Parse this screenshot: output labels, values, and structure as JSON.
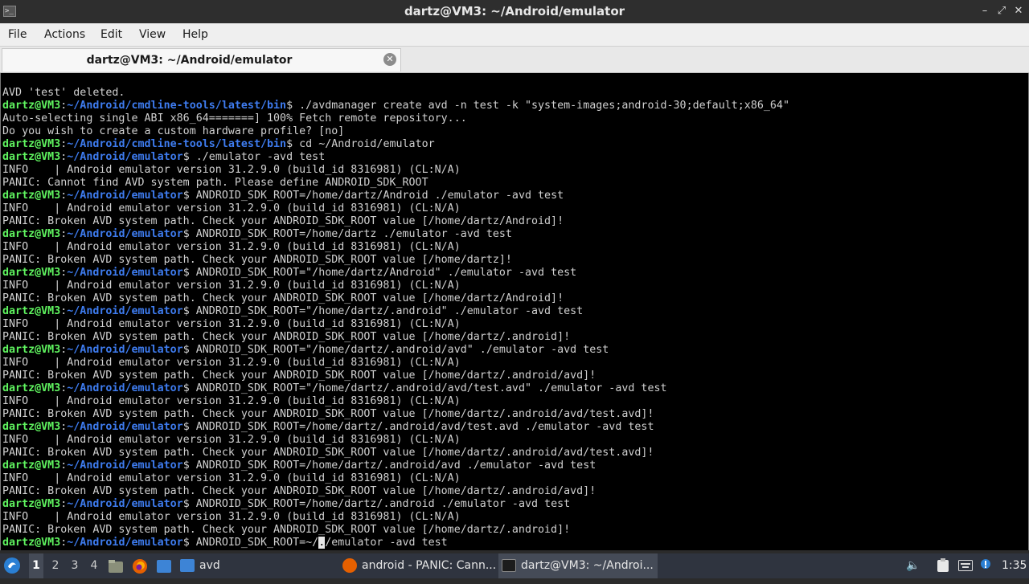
{
  "window": {
    "title": "dartz@VM3: ~/Android/emulator",
    "app_icon": "terminal-icon",
    "controls": {
      "minimize": "minimize-icon",
      "maximize": "maximize-icon",
      "close": "close-icon"
    }
  },
  "menu": {
    "items": [
      "File",
      "Actions",
      "Edit",
      "View",
      "Help"
    ]
  },
  "tab": {
    "title": "dartz@VM3: ~/Android/emulator",
    "close_icon": "close-circle-icon"
  },
  "terminal": {
    "colors": {
      "background": "#000000",
      "text": "#d0d0d0",
      "user": "#5ff35f",
      "path": "#3e7cf0"
    },
    "lines": [
      {
        "text": "AVD 'test' deleted."
      },
      {
        "user": "dartz@VM3",
        "path": "~/Android/cmdline-tools/latest/bin",
        "cmd": " ./avdmanager create avd -n test -k \"system-images;android-30;default;x86_64\""
      },
      {
        "text": "Auto-selecting single ABI x86_64=======] 100% Fetch remote repository..."
      },
      {
        "text": "Do you wish to create a custom hardware profile? [no]"
      },
      {
        "user": "dartz@VM3",
        "path": "~/Android/cmdline-tools/latest/bin",
        "cmd": " cd ~/Android/emulator"
      },
      {
        "user": "dartz@VM3",
        "path": "~/Android/emulator",
        "cmd": " ./emulator -avd test"
      },
      {
        "text": "INFO    | Android emulator version 31.2.9.0 (build_id 8316981) (CL:N/A)"
      },
      {
        "text": "PANIC: Cannot find AVD system path. Please define ANDROID_SDK_ROOT"
      },
      {
        "user": "dartz@VM3",
        "path": "~/Android/emulator",
        "cmd": " ANDROID_SDK_ROOT=/home/dartz/Android ./emulator -avd test"
      },
      {
        "text": "INFO    | Android emulator version 31.2.9.0 (build_id 8316981) (CL:N/A)"
      },
      {
        "text": "PANIC: Broken AVD system path. Check your ANDROID_SDK_ROOT value [/home/dartz/Android]!"
      },
      {
        "user": "dartz@VM3",
        "path": "~/Android/emulator",
        "cmd": " ANDROID_SDK_ROOT=/home/dartz ./emulator -avd test"
      },
      {
        "text": "INFO    | Android emulator version 31.2.9.0 (build_id 8316981) (CL:N/A)"
      },
      {
        "text": "PANIC: Broken AVD system path. Check your ANDROID_SDK_ROOT value [/home/dartz]!"
      },
      {
        "user": "dartz@VM3",
        "path": "~/Android/emulator",
        "cmd": " ANDROID_SDK_ROOT=\"/home/dartz/Android\" ./emulator -avd test"
      },
      {
        "text": "INFO    | Android emulator version 31.2.9.0 (build_id 8316981) (CL:N/A)"
      },
      {
        "text": "PANIC: Broken AVD system path. Check your ANDROID_SDK_ROOT value [/home/dartz/Android]!"
      },
      {
        "user": "dartz@VM3",
        "path": "~/Android/emulator",
        "cmd": " ANDROID_SDK_ROOT=\"/home/dartz/.android\" ./emulator -avd test"
      },
      {
        "text": "INFO    | Android emulator version 31.2.9.0 (build_id 8316981) (CL:N/A)"
      },
      {
        "text": "PANIC: Broken AVD system path. Check your ANDROID_SDK_ROOT value [/home/dartz/.android]!"
      },
      {
        "user": "dartz@VM3",
        "path": "~/Android/emulator",
        "cmd": " ANDROID_SDK_ROOT=\"/home/dartz/.android/avd\" ./emulator -avd test"
      },
      {
        "text": "INFO    | Android emulator version 31.2.9.0 (build_id 8316981) (CL:N/A)"
      },
      {
        "text": "PANIC: Broken AVD system path. Check your ANDROID_SDK_ROOT value [/home/dartz/.android/avd]!"
      },
      {
        "user": "dartz@VM3",
        "path": "~/Android/emulator",
        "cmd": " ANDROID_SDK_ROOT=\"/home/dartz/.android/avd/test.avd\" ./emulator -avd test"
      },
      {
        "text": "INFO    | Android emulator version 31.2.9.0 (build_id 8316981) (CL:N/A)"
      },
      {
        "text": "PANIC: Broken AVD system path. Check your ANDROID_SDK_ROOT value [/home/dartz/.android/avd/test.avd]!"
      },
      {
        "user": "dartz@VM3",
        "path": "~/Android/emulator",
        "cmd": " ANDROID_SDK_ROOT=/home/dartz/.android/avd/test.avd ./emulator -avd test"
      },
      {
        "text": "INFO    | Android emulator version 31.2.9.0 (build_id 8316981) (CL:N/A)"
      },
      {
        "text": "PANIC: Broken AVD system path. Check your ANDROID_SDK_ROOT value [/home/dartz/.android/avd/test.avd]!"
      },
      {
        "user": "dartz@VM3",
        "path": "~/Android/emulator",
        "cmd": " ANDROID_SDK_ROOT=/home/dartz/.android/avd ./emulator -avd test"
      },
      {
        "text": "INFO    | Android emulator version 31.2.9.0 (build_id 8316981) (CL:N/A)"
      },
      {
        "text": "PANIC: Broken AVD system path. Check your ANDROID_SDK_ROOT value [/home/dartz/.android/avd]!"
      },
      {
        "user": "dartz@VM3",
        "path": "~/Android/emulator",
        "cmd": " ANDROID_SDK_ROOT=/home/dartz/.android ./emulator -avd test"
      },
      {
        "text": "INFO    | Android emulator version 31.2.9.0 (build_id 8316981) (CL:N/A)"
      },
      {
        "text": "PANIC: Broken AVD system path. Check your ANDROID_SDK_ROOT value [/home/dartz/.android]!"
      },
      {
        "user": "dartz@VM3",
        "path": "~/Android/emulator",
        "cmd": " ANDROID_SDK_ROOT=~/",
        "cursor": ".",
        "cmd_after": "/emulator -avd test"
      }
    ]
  },
  "taskbar": {
    "start_icon": "start-menu-icon",
    "workspaces": [
      "1",
      "2",
      "3",
      "4"
    ],
    "active_workspace": "1",
    "launchers": [
      "file-manager-icon",
      "firefox-icon",
      "show-desktop-icon"
    ],
    "folder": {
      "icon": "folder-icon",
      "label": "avd"
    },
    "tasks": [
      {
        "icon": "firefox-icon",
        "label": "android - PANIC: Cann..."
      },
      {
        "icon": "terminal-icon",
        "label": "dartz@VM3: ~/Androi..."
      }
    ],
    "tray": [
      "volume-icon",
      "clipboard-icon",
      "keyboard-icon",
      "update-notifier-icon"
    ],
    "clock": "1:35"
  }
}
